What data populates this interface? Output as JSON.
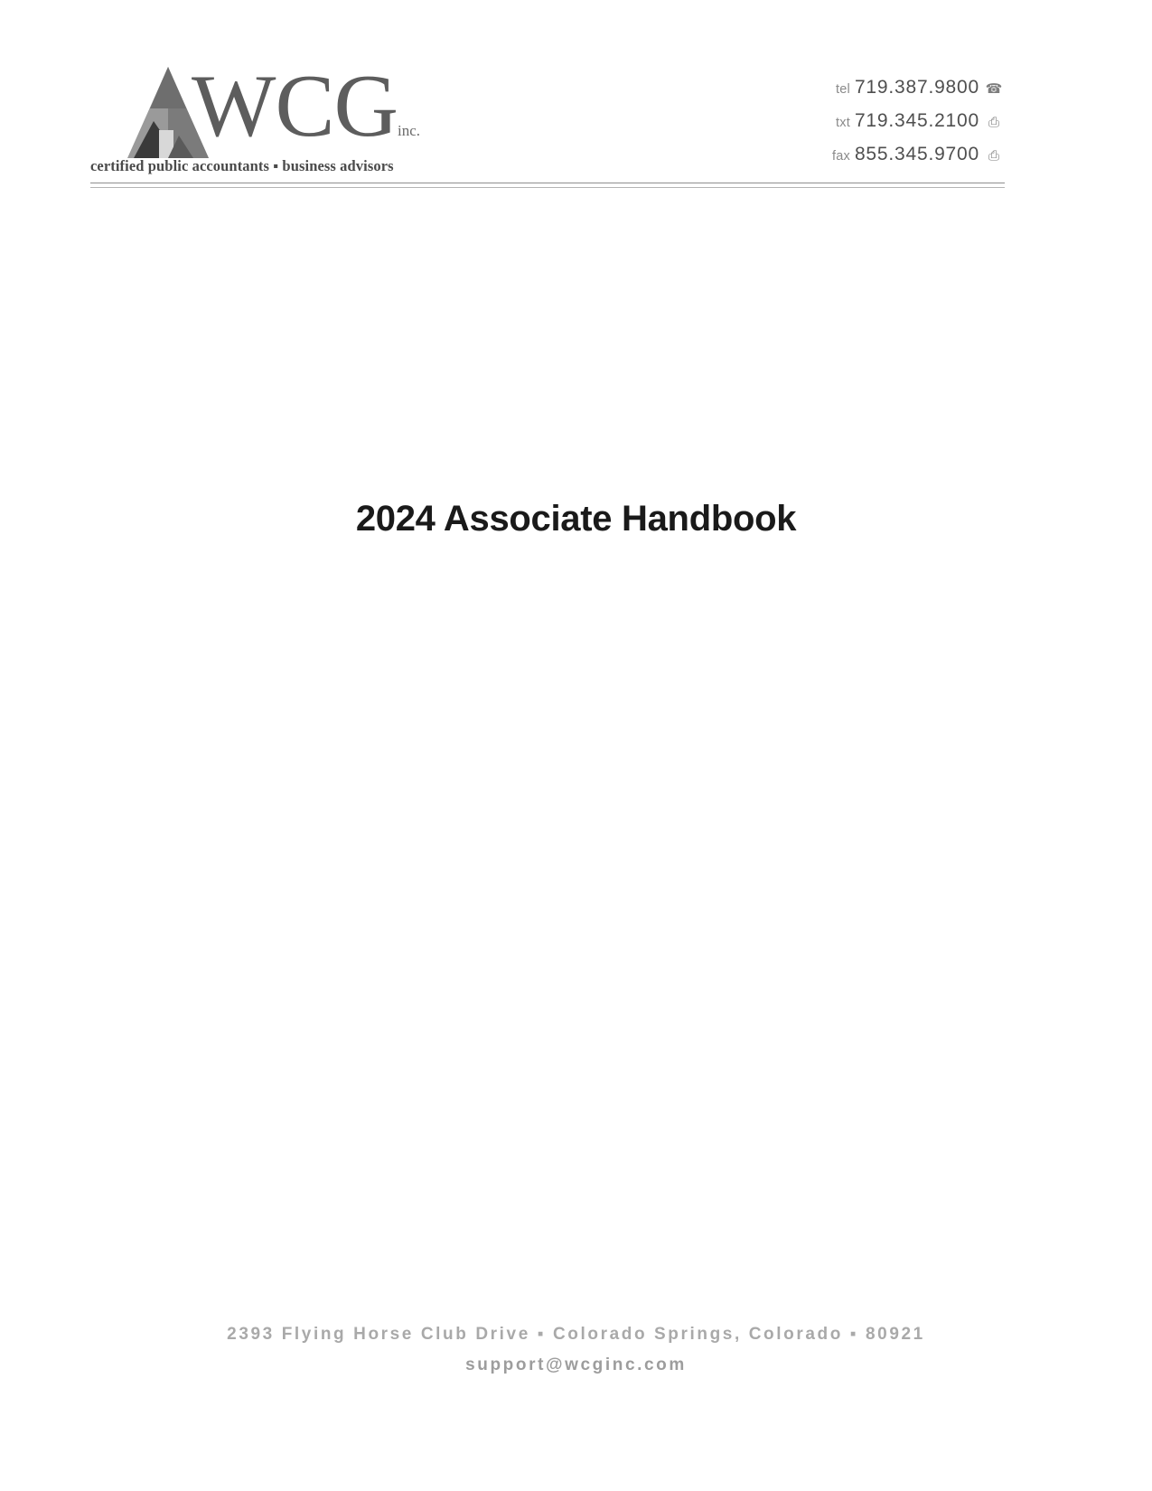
{
  "letterhead": {
    "logo": {
      "mark_icon": "mountain-triangle-logo-icon",
      "wordmark": "WCG",
      "wordmark_suffix": "inc.",
      "tagline": "certified public accountants  ▪  business advisors"
    },
    "contact": [
      {
        "label": "tel",
        "number": "719.387.9800",
        "icon": "telephone-icon",
        "glyph": "☎"
      },
      {
        "label": "txt",
        "number": "719.345.2100",
        "icon": "mobile-phone-icon",
        "glyph": "⎙"
      },
      {
        "label": "fax",
        "number": "855.345.9700",
        "icon": "fax-machine-icon",
        "glyph": "⎙"
      }
    ]
  },
  "title": "2024 Associate Handbook",
  "footer": {
    "address": "2393 Flying Horse Club Drive ▪ Colorado Springs, Colorado ▪ 80921",
    "email": "support@wcginc.com"
  },
  "colors": {
    "logo_gray": "#5d5d5d",
    "text_black": "#1a1a1a",
    "footer_gray": "#a9a9a9",
    "rule_gray": "#8e8e8e"
  }
}
